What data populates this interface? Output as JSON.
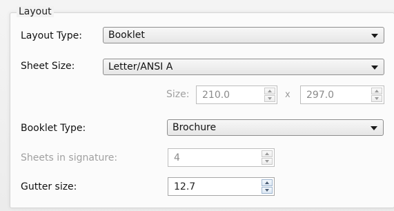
{
  "group": {
    "title": "Layout"
  },
  "layout_type": {
    "label": "Layout Type:",
    "value": "Booklet"
  },
  "sheet_size": {
    "label": "Sheet Size:",
    "value": "Letter/ANSI A"
  },
  "custom_size": {
    "label": "Size:",
    "width": "210.0",
    "separator": "x",
    "height": "297.0"
  },
  "booklet_type": {
    "label": "Booklet Type:",
    "value": "Brochure"
  },
  "sheets_in_signature": {
    "label": "Sheets in signature:",
    "value": "4"
  },
  "gutter_size": {
    "label": "Gutter size:",
    "value": "12.7"
  },
  "icons": {
    "dropdown": "chevron-down-icon",
    "spin_up": "spin-up-icon",
    "spin_down": "spin-down-icon"
  }
}
